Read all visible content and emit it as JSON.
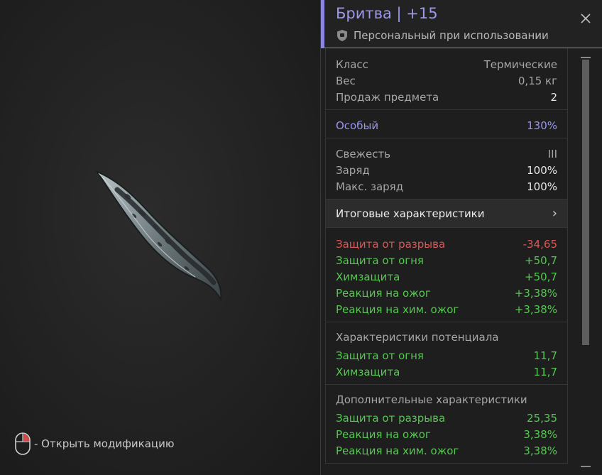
{
  "item": {
    "title": "Бритва | +15",
    "binding": "Персональный при использовании"
  },
  "icons": {
    "binding": "shield-icon",
    "close": "close-icon",
    "mouse": "mouse-right-click-icon",
    "arrow": "chevron-right-icon"
  },
  "stats_basic": [
    {
      "label": "Класс",
      "value": "Термические"
    },
    {
      "label": "Вес",
      "value": "0,15 кг"
    },
    {
      "label": "Продаж предмета",
      "value": "2"
    }
  ],
  "special": {
    "label": "Особый",
    "value": "130%"
  },
  "state": [
    {
      "label": "Свежесть",
      "value": "III"
    },
    {
      "label": "Заряд",
      "value": "100%"
    },
    {
      "label": "Макс. заряд",
      "value": "100%"
    }
  ],
  "total_button": {
    "label": "Итоговые характеристики",
    "arrow": "›"
  },
  "totals": [
    {
      "label": "Защита от разрыва",
      "value": "-34,65",
      "tone": "red"
    },
    {
      "label": "Защита от огня",
      "value": "+50,7",
      "tone": "green"
    },
    {
      "label": "Химзащита",
      "value": "+50,7",
      "tone": "green"
    },
    {
      "label": "Реакция на ожог",
      "value": "+3,38%",
      "tone": "green"
    },
    {
      "label": "Реакция на хим. ожог",
      "value": "+3,38%",
      "tone": "green"
    }
  ],
  "potential": {
    "title": "Характеристики потенциала",
    "rows": [
      {
        "label": "Защита от огня",
        "value": "11,7"
      },
      {
        "label": "Химзащита",
        "value": "11,7"
      }
    ]
  },
  "additional": {
    "title": "Дополнительные характеристики",
    "rows": [
      {
        "label": "Защита от разрыва",
        "value": "25,35"
      },
      {
        "label": "Реакция на ожог",
        "value": "3,38%"
      },
      {
        "label": "Реакция на хим. ожог",
        "value": "3,38%"
      }
    ]
  },
  "hint": {
    "text": "- Открыть модификацию"
  },
  "colors": {
    "accent": "#8b86e0",
    "positive": "#54c850",
    "negative": "#d95858"
  }
}
